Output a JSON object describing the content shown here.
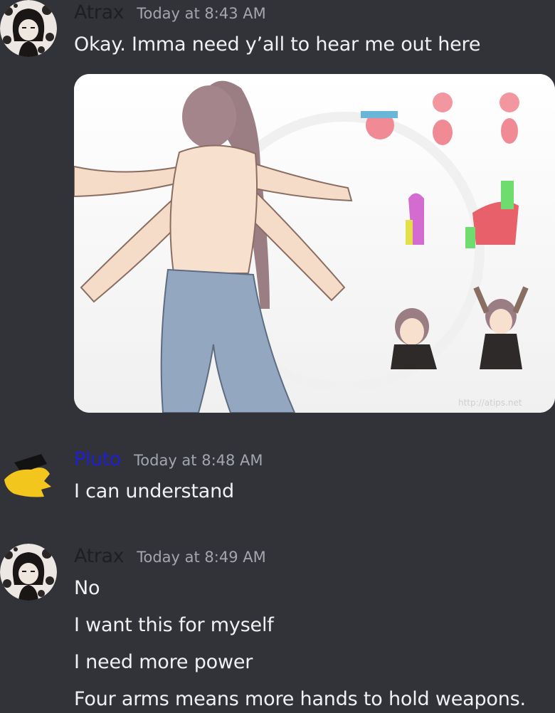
{
  "messages": [
    {
      "author": "Atrax",
      "author_color": "#1e1f22",
      "timestamp": "Today at 8:43 AM",
      "lines": [
        "Okay. Imma need y’all to hear me out here"
      ],
      "attachment": {
        "watermark": "http://atips.net"
      }
    },
    {
      "author": "Pluto",
      "author_color": "#1f1fd1",
      "timestamp": "Today at 8:48 AM",
      "lines": [
        "I can understand"
      ]
    },
    {
      "author": "Atrax",
      "author_color": "#1e1f22",
      "timestamp": "Today at 8:49 AM",
      "lines": [
        "No",
        "I want this for myself",
        "I need more power",
        "Four arms means more hands to hold weapons."
      ]
    }
  ],
  "colors": {
    "background": "#313338",
    "text": "#f0f1f3",
    "timestamp": "#a3a6ad"
  }
}
